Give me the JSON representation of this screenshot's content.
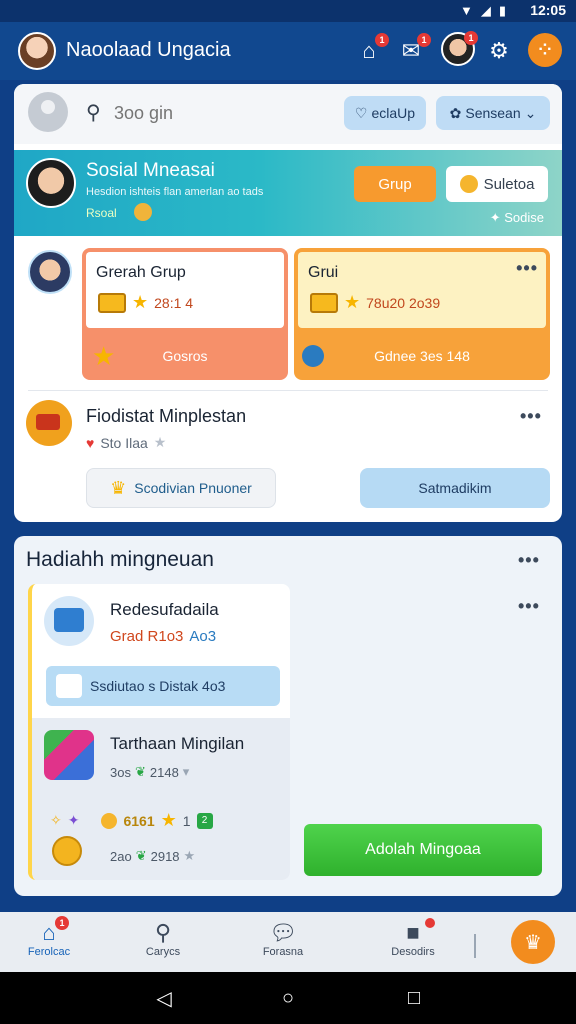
{
  "status_bar": {
    "time": "12:05"
  },
  "header": {
    "title": "Naoolaad Ungacia",
    "badge_count": "1"
  },
  "search": {
    "placeholder": "3oo gin",
    "filter_label": "eclaUp",
    "dropdown_label": "Sensean"
  },
  "banner": {
    "title": "Sosial Mneasai",
    "subtitle": "Hesdion ishteis flan amerlan ao tads",
    "tag": "Rsoal",
    "btn_grup": "Grup",
    "btn_solution": "Suletoa",
    "right_text": "Sodise"
  },
  "groups": [
    {
      "name": "Grerah Grup",
      "value": "28:1 4",
      "bottom": "Gosros"
    },
    {
      "name": "Grui",
      "value": "78u20 2o39",
      "bottom": "Gdnee 3es 148"
    }
  ],
  "event": {
    "title": "Fiodistat Minplestan",
    "meta": "Sto Ilaa",
    "btn_primary": "Scodivian Pnuoner",
    "btn_secondary": "Satmadikim"
  },
  "weekly": {
    "title": "Hadiahh mingneuan",
    "item1_title": "Redesufadaila",
    "item1_sub": "Grad R1o3",
    "item1_sub_blue": "Ao3",
    "tag": "Ssdiutao s Distak 4o3",
    "item2_title": "Tarthaan Mingilan",
    "item2_meta_a": "3os",
    "item2_meta_b": "2148",
    "row2_a": "6161",
    "row2_b": "1",
    "row2_c": "2",
    "row3_a": "2ao",
    "row3_b": "2918",
    "cta": "Adolah Mingoaa"
  },
  "nav": [
    {
      "label": "Ferolcac"
    },
    {
      "label": "Carycs"
    },
    {
      "label": "Forasna"
    },
    {
      "label": "Desodirs"
    }
  ],
  "colors": {
    "header": "#11488f",
    "accent_orange": "#f28c1e",
    "accent_green": "#2fb12d",
    "teal": "#1fa7c6"
  }
}
